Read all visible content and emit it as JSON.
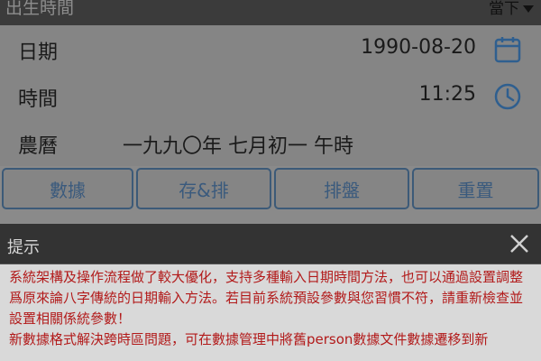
{
  "topbar": {
    "title": "出生時間",
    "tz_label": "當下"
  },
  "date_row": {
    "label": "日期",
    "value": "1990-08-20"
  },
  "time_row": {
    "label": "時間",
    "value": "11:25"
  },
  "lunar_row": {
    "label": "農曆",
    "value": "一九九〇年 七月初一 午時"
  },
  "buttons": {
    "data": "數據",
    "save_arrange": "存&排",
    "arrange": "排盤",
    "reset": "重置"
  },
  "dialog": {
    "title": "提示",
    "paragraph1": "系統架構及操作流程做了較大優化，支持多種輸入日期時間方法，也可以通過設置調整爲原來論八字傳統的日期輸入方法。若目前系統預設參數與您習慣不符，請重新檢查並設置相關係統參數！",
    "paragraph2": "新數據格式解決跨時區問題，可在數據管理中將舊person數據文件數據遷移到新"
  },
  "colors": {
    "accent": "#3c5a78",
    "notice_text": "#b21a1a"
  },
  "icons": {
    "date": "calendar-icon",
    "time": "clock-icon",
    "tz": "chevron-down-icon",
    "close": "close-icon"
  }
}
